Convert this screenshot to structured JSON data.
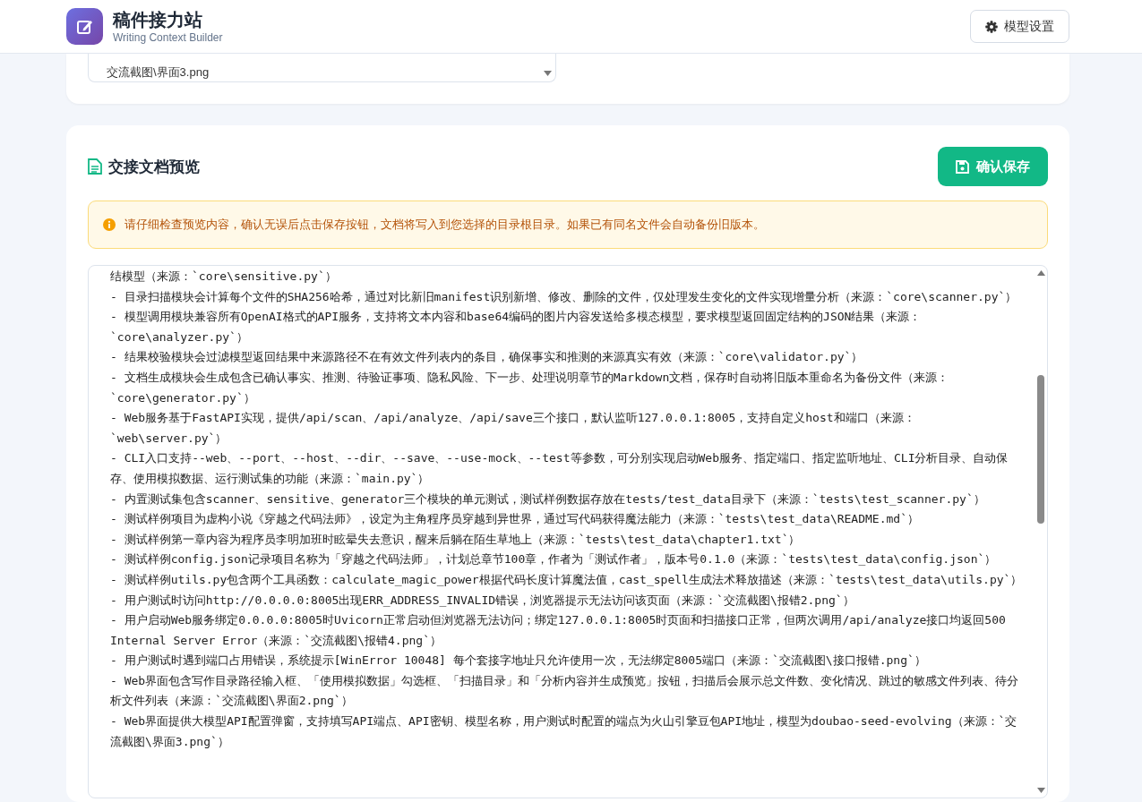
{
  "header": {
    "app_title": "稿件接力站",
    "app_subtitle": "Writing Context Builder",
    "settings_button": "模型设置"
  },
  "file_list": {
    "items": [
      "交流截图\\界面3.png"
    ]
  },
  "preview": {
    "title": "交接文档预览",
    "save_button": "确认保存",
    "notice": "请仔细检查预览内容，确认无误后点击保存按钮，文档将写入到您选择的目录根目录。如果已有同名文件会自动备份旧版本。",
    "lines": [
      "结模型（来源：`core\\sensitive.py`）",
      "- 目录扫描模块会计算每个文件的SHA256哈希，通过对比新旧manifest识别新增、修改、删除的文件，仅处理发生变化的文件实现增量分析（来源：`core\\scanner.py`）",
      "- 模型调用模块兼容所有OpenAI格式的API服务，支持将文本内容和base64编码的图片内容发送给多模态模型，要求模型返回固定结构的JSON结果（来源：`core\\analyzer.py`）",
      "- 结果校验模块会过滤模型返回结果中来源路径不在有效文件列表内的条目，确保事实和推测的来源真实有效（来源：`core\\validator.py`）",
      "- 文档生成模块会生成包含已确认事实、推测、待验证事项、隐私风险、下一步、处理说明章节的Markdown文档，保存时自动将旧版本重命名为备份文件（来源：`core\\generator.py`）",
      "- Web服务基于FastAPI实现，提供/api/scan、/api/analyze、/api/save三个接口，默认监听127.0.0.1:8005，支持自定义host和端口（来源：`web\\server.py`）",
      "- CLI入口支持--web、--port、--host、--dir、--save、--use-mock、--test等参数，可分别实现启动Web服务、指定端口、指定监听地址、CLI分析目录、自动保存、使用模拟数据、运行测试集的功能（来源：`main.py`）",
      "- 内置测试集包含scanner、sensitive、generator三个模块的单元测试，测试样例数据存放在tests/test_data目录下（来源：`tests\\test_scanner.py`）",
      "- 测试样例项目为虚构小说《穿越之代码法师》，设定为主角程序员穿越到异世界，通过写代码获得魔法能力（来源：`tests\\test_data\\README.md`）",
      "- 测试样例第一章内容为程序员李明加班时眩晕失去意识，醒来后躺在陌生草地上（来源：`tests\\test_data\\chapter1.txt`）",
      "- 测试样例config.json记录项目名称为「穿越之代码法师」，计划总章节100章，作者为「测试作者」，版本号0.1.0（来源：`tests\\test_data\\config.json`）",
      "- 测试样例utils.py包含两个工具函数：calculate_magic_power根据代码长度计算魔法值，cast_spell生成法术释放描述（来源：`tests\\test_data\\utils.py`）",
      "- 用户测试时访问http://0.0.0.0:8005出现ERR_ADDRESS_INVALID错误，浏览器提示无法访问该页面（来源：`交流截图\\报错2.png`）",
      "- 用户启动Web服务绑定0.0.0.0:8005时Uvicorn正常启动但浏览器无法访问；绑定127.0.0.1:8005时页面和扫描接口正常，但两次调用/api/analyze接口均返回500 Internal Server Error（来源：`交流截图\\报错4.png`）",
      "- 用户测试时遇到端口占用错误，系统提示[WinError 10048] 每个套接字地址只允许使用一次，无法绑定8005端口（来源：`交流截图\\接口报错.png`）",
      "- Web界面包含写作目录路径输入框、「使用模拟数据」勾选框、「扫描目录」和「分析内容并生成预览」按钮，扫描后会展示总文件数、变化情况、跳过的敏感文件列表、待分析文件列表（来源：`交流截图\\界面2.png`）",
      "- Web界面提供大模型API配置弹窗，支持填写API端点、API密钥、模型名称，用户测试时配置的端点为火山引擎豆包API地址，模型为doubao-seed-evolving（来源：`交流截图\\界面3.png`）"
    ]
  }
}
